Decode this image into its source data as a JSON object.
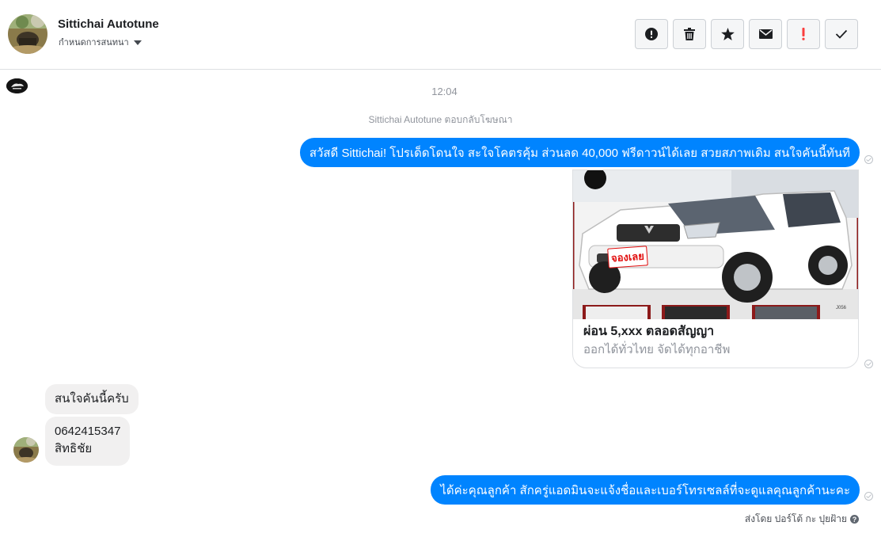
{
  "header": {
    "contact_name": "Sittichai Autotune",
    "assign_label": "กำหนดการสนทนา",
    "actions": [
      {
        "name": "report-spam-button",
        "icon": "exclamation-circle-icon"
      },
      {
        "name": "delete-button",
        "icon": "trash-icon"
      },
      {
        "name": "star-button",
        "icon": "star-icon"
      },
      {
        "name": "mark-unread-button",
        "icon": "envelope-icon"
      },
      {
        "name": "follow-up-button",
        "icon": "exclamation-red-icon"
      },
      {
        "name": "mark-done-button",
        "icon": "checkmark-icon"
      }
    ]
  },
  "conversation": {
    "timestamp": "12:04",
    "ad_reply_note": "Sittichai Autotune ตอบกลับโฆษณา",
    "messages": [
      {
        "direction": "out",
        "text": "สวัสดี Sittichai! โปรเด็ดโดนใจ สะใจโคตรคุ้ม ส่วนลด 40,000 ฟรีดาวน์ได้เลย สวยสภาพเดิม สนใจคันนี้ทันที"
      },
      {
        "direction": "out",
        "type": "card",
        "title": "ผ่อน 5,xxx ตลอดสัญญา",
        "subtitle": "ออกได้ทั่วไทย จัดได้ทุกอาชีพ",
        "image_badge": "จองเลย",
        "image_watermark": "J056"
      },
      {
        "direction": "in",
        "text": "สนใจคันนี้ครับ"
      },
      {
        "direction": "in",
        "text_line1": "0642415347",
        "text_line2": "สิทธิชัย"
      },
      {
        "direction": "out",
        "text": "ได้ค่ะคุณลูกค้า สักครู่แอดมินจะแจ้งชื่อและเบอร์โทรเซลล์ที่จะดูแลคุณลูกค้านะคะ"
      }
    ],
    "sent_by": "ส่งโดย ปอร์โต้ กะ ปุยฝ้าย"
  },
  "colors": {
    "outgoing_bubble": "#0084ff",
    "incoming_bubble": "#f1f0f0",
    "follow_up_red": "#fa3e3e"
  }
}
